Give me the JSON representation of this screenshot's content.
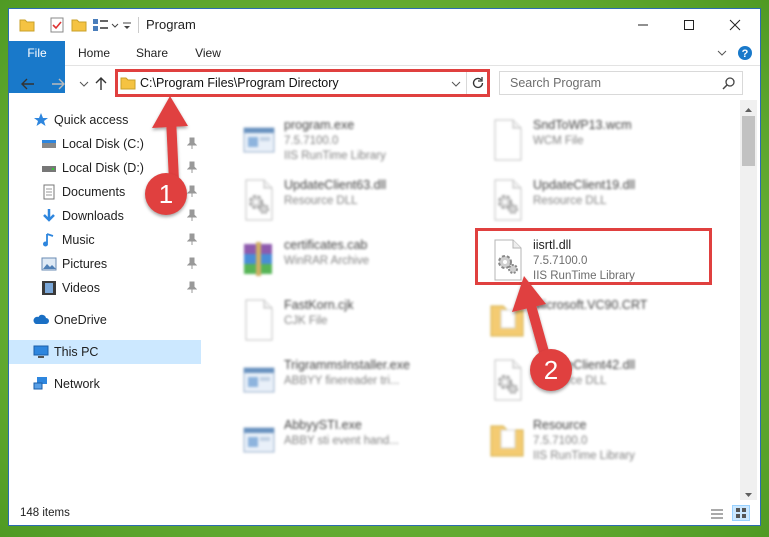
{
  "window": {
    "title": "Program",
    "controls": [
      "minimize",
      "maximize",
      "close"
    ]
  },
  "ribbon": {
    "tabs": [
      "File",
      "Home",
      "Share",
      "View"
    ]
  },
  "navigation": {
    "address": "C:\\Program Files\\Program Directory",
    "search_placeholder": "Search Program"
  },
  "sidebar": {
    "items": [
      {
        "label": "Quick access",
        "icon": "star-icon",
        "pinned": false
      },
      {
        "label": "Local Disk (C:)",
        "icon": "drive-icon",
        "pinned": true
      },
      {
        "label": "Local Disk (D:)",
        "icon": "drive-icon",
        "pinned": true
      },
      {
        "label": "Documents",
        "icon": "documents-icon",
        "pinned": true
      },
      {
        "label": "Downloads",
        "icon": "download-icon",
        "pinned": true
      },
      {
        "label": "Music",
        "icon": "music-icon",
        "pinned": true
      },
      {
        "label": "Pictures",
        "icon": "pictures-icon",
        "pinned": true
      },
      {
        "label": "Videos",
        "icon": "videos-icon",
        "pinned": true
      },
      {
        "label": "OneDrive",
        "icon": "cloud-icon",
        "pinned": false
      },
      {
        "label": "This PC",
        "icon": "computer-icon",
        "pinned": false,
        "selected": true
      },
      {
        "label": "Network",
        "icon": "network-icon",
        "pinned": false
      }
    ]
  },
  "files": [
    {
      "name": "program.exe",
      "line2": "7.5.7100.0",
      "line3": "IIS RunTime Library",
      "icon": "exe-icon"
    },
    {
      "name": "SndToWP13.wcm",
      "line2": "WCM File",
      "line3": "",
      "icon": "blank-file-icon"
    },
    {
      "name": "UpdateClient63.dll",
      "line2": "Resource DLL",
      "line3": "",
      "icon": "dll-gear-icon"
    },
    {
      "name": "UpdateClient19.dll",
      "line2": "Resource DLL",
      "line3": "",
      "icon": "dll-gear-icon"
    },
    {
      "name": "certificates.cab",
      "line2": "WinRAR Archive",
      "line3": "",
      "icon": "winrar-icon"
    },
    {
      "name": "iisrtl.dll",
      "line2": "7.5.7100.0",
      "line3": "IIS RunTime Library",
      "icon": "dll-gear-icon"
    },
    {
      "name": "FastKorn.cjk",
      "line2": "CJK File",
      "line3": "",
      "icon": "blank-file-icon"
    },
    {
      "name": "Microsoft.VC90.CRT",
      "line2": "",
      "line3": "",
      "icon": "folder-icon"
    },
    {
      "name": "TrigrammsInstaller.exe",
      "line2": "ABBYY finereader tri...",
      "line3": "",
      "icon": "exe-icon"
    },
    {
      "name": "UpdateClient42.dll",
      "line2": "Resource DLL",
      "line3": "",
      "icon": "dll-gear-icon"
    },
    {
      "name": "AbbyySTI.exe",
      "line2": "ABBY sti event hand...",
      "line3": "",
      "icon": "exe-icon"
    },
    {
      "name": "Resource",
      "line2": "7.5.7100.0",
      "line3": "IIS RunTime Library",
      "icon": "folder-icon"
    }
  ],
  "status": {
    "item_count": "148 items"
  },
  "annotations": {
    "callout_1": "1",
    "callout_2": "2"
  },
  "colors": {
    "accent": "#1979ca",
    "highlight": "#e0403f",
    "selected_bg": "#cce8ff",
    "background": "#6cb337"
  }
}
